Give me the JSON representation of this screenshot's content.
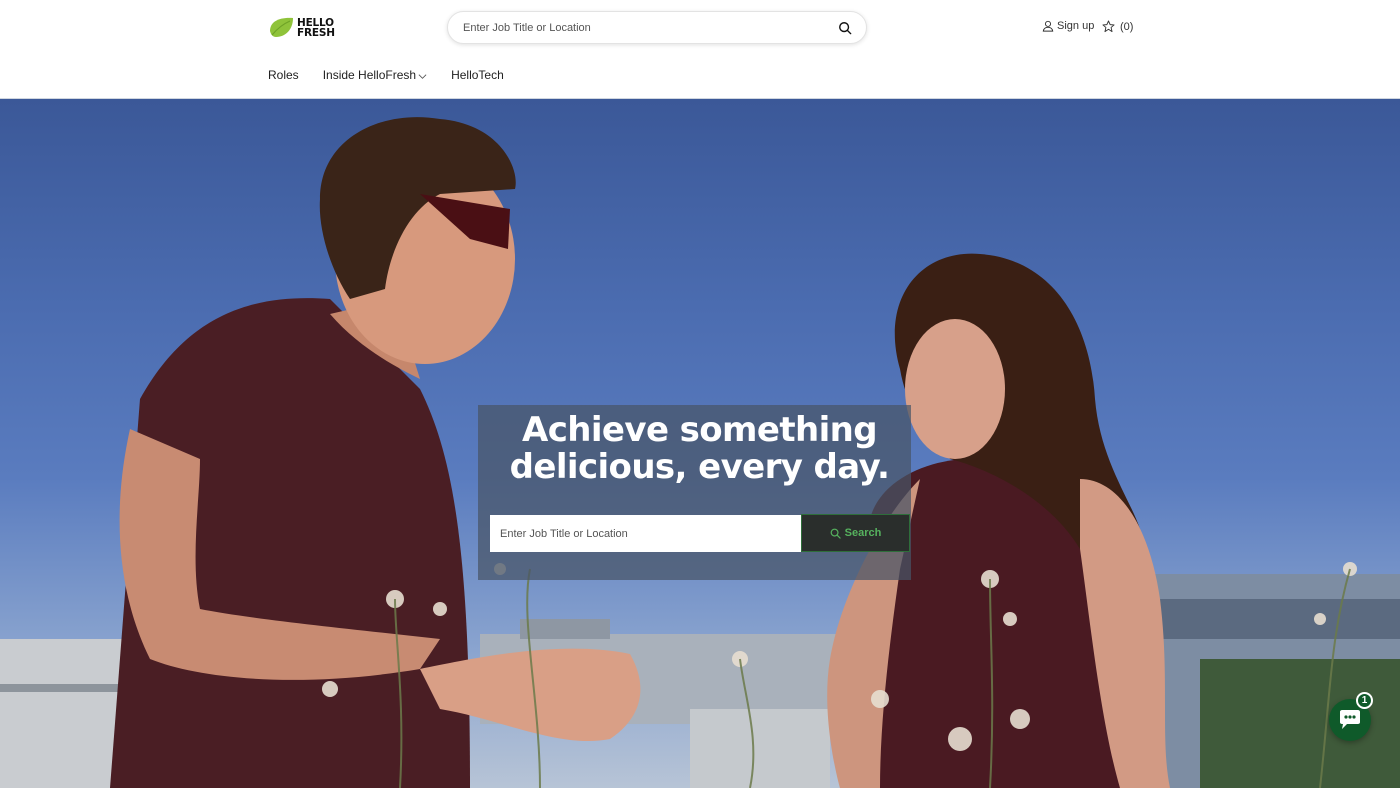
{
  "header": {
    "logo": {
      "line1": "HELLO",
      "line2": "FRESH",
      "leaf_color": "#8fc33a"
    },
    "search": {
      "placeholder": "Enter Job Title or Location",
      "icon": "search-icon"
    },
    "signup_label": "Sign up",
    "saved_count": "(0)"
  },
  "nav": {
    "items": [
      {
        "label": "Roles"
      },
      {
        "label": "Inside HelloFresh",
        "has_dropdown": true
      },
      {
        "label": "HelloTech"
      }
    ]
  },
  "hero": {
    "title_line1": "Achieve something",
    "title_line2": "delicious, every day.",
    "search": {
      "placeholder": "Enter Job Title or Location",
      "button_label": "Search"
    },
    "button_text_color": "#56b25e"
  },
  "chat": {
    "badge_count": "1",
    "color": "#0f5a2a"
  }
}
